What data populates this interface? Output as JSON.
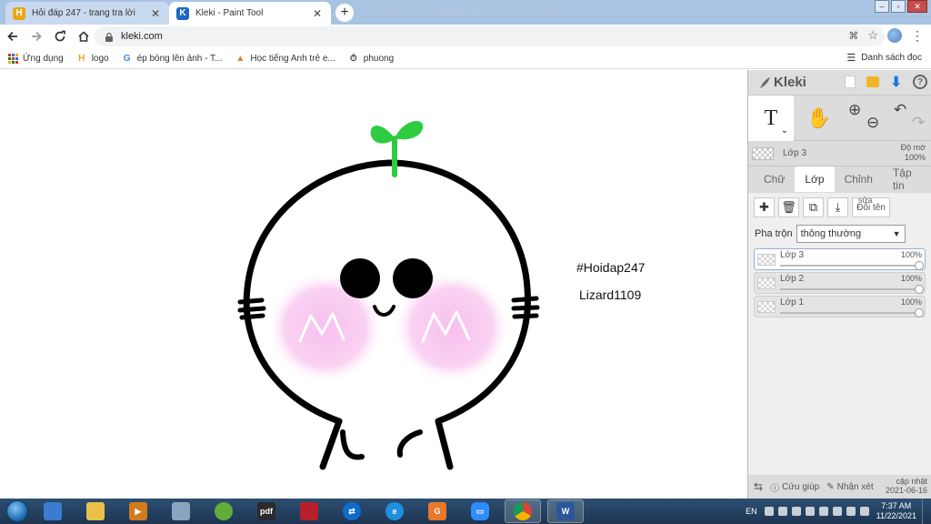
{
  "browser": {
    "tabs": [
      {
        "title": "Hỏi đáp 247 - trang tra lời",
        "favicon": "hoidap-h-icon",
        "active": false
      },
      {
        "title": "Kleki - Paint Tool",
        "favicon": "kleki-icon",
        "active": true
      }
    ],
    "faint_window_title": "Document - Compatibility Mode - Microsoft Word",
    "url": "kleki.com",
    "bookmarks": [
      {
        "label": "Ứng dụng",
        "icon": "apps-grid-icon"
      },
      {
        "label": "logo",
        "icon": "hoidap-h-icon"
      },
      {
        "label": "ép bóng lên ảnh - T...",
        "icon": "google-g-icon"
      },
      {
        "label": "Học tiếng Anh trẻ e...",
        "icon": "triangle-icon"
      },
      {
        "label": "phuong",
        "icon": "timer-icon"
      }
    ],
    "reading_list": "Danh sách đọc"
  },
  "canvas": {
    "texts": [
      "#Hoidap247",
      "Lizard1109"
    ]
  },
  "kleki": {
    "brand": "Kleki",
    "current_layer": {
      "name": "Lớp 3",
      "opacity_label": "Độ mờ",
      "opacity_value": "100%"
    },
    "tabs": [
      {
        "label": "Chữ",
        "selected": false
      },
      {
        "label": "Lớp",
        "selected": true
      },
      {
        "label": "Chỉnh",
        "selected": false
      },
      {
        "label": "Tập tin",
        "selected": false
      }
    ],
    "rename_button": "Đổi tên",
    "rename_overlay": "sửa",
    "blend_label": "Pha trộn",
    "blend_value": "thông thường",
    "layers": [
      {
        "name": "Lớp 3",
        "opacity": "100%",
        "opacity_fraction": 1.0,
        "selected": true
      },
      {
        "name": "Lớp 2",
        "opacity": "100%",
        "opacity_fraction": 1.0,
        "selected": false
      },
      {
        "name": "Lớp 1",
        "opacity": "100%",
        "opacity_fraction": 1.0,
        "selected": false
      }
    ],
    "footer": {
      "help": "Cứu giúp",
      "feedback": "Nhận xét",
      "version_label": "cập nhật",
      "version_date": "2021-06-16"
    }
  },
  "taskbar": {
    "apps": [
      "explorer-icon",
      "folder-icon",
      "media-player-icon",
      "calculator-icon",
      "greenshot-icon",
      "pdf-pro-icon",
      "flash-icon",
      "teamviewer-icon",
      "internet-explorer-icon",
      "foxit-pdf-icon",
      "zoom-icon",
      "chrome-icon",
      "word-icon"
    ],
    "active_apps": [
      "chrome-icon",
      "word-icon"
    ],
    "language": "EN",
    "time": "7:37 AM",
    "date": "11/22/2021"
  },
  "colors": {
    "tabbar": "#a9c3e3",
    "panel": "#dcdcdc",
    "sprout": "#2ecc40",
    "blush": "#f9c8ef",
    "accent_download": "#1a73e8"
  }
}
